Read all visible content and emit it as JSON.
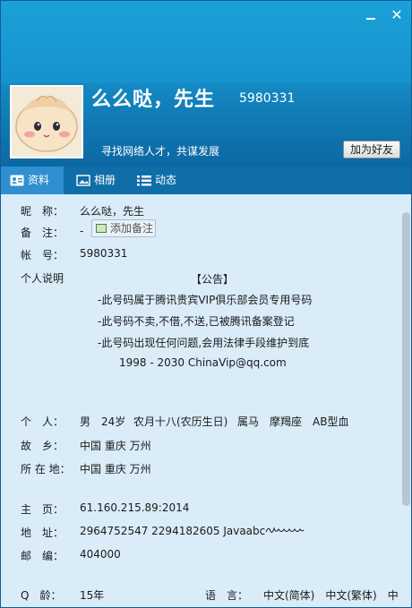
{
  "window": {
    "minimize_label": "—",
    "close_label": "✕"
  },
  "profile": {
    "nickname": "么么哒，先生",
    "qq_number": "5980331",
    "slogan": "寻找网络人才，共谋发展",
    "add_friend_label": "加为好友"
  },
  "tabs": [
    {
      "label": "资料",
      "icon": "profile-card-icon"
    },
    {
      "label": "相册",
      "icon": "photo-album-icon"
    },
    {
      "label": "动态",
      "icon": "list-feed-icon"
    }
  ],
  "info": {
    "nickname_label": "昵　称：",
    "nickname_value": "么么哒，先生",
    "remark_label": "备　注：",
    "remark_value": "-",
    "remark_button": "添加备注",
    "account_label": "帐　号：",
    "account_value": "5980331",
    "personal_desc_label": "个人说明",
    "notice_title": "【公告】",
    "notice_lines": [
      "-此号码属于腾讯贵宾VIP俱乐部会员专用号码",
      "-此号码不卖,不借,不送,已被腾讯备案登记",
      "-此号码出现任何问题,会用法律手段维护到底",
      "1998 - 2030 ChinaVip@qq.com"
    ],
    "person_label": "个　人：",
    "person_gender": "男",
    "person_age": "24岁",
    "person_birthday": "农月十八(农历生日)",
    "person_zodiac": "属马",
    "person_constellation": "摩羯座",
    "person_blood": "AB型血",
    "hometown_label": "故　乡：",
    "hometown_value": "中国 重庆 万州",
    "location_label": "所 在 地：",
    "location_value": "中国 重庆 万州",
    "homepage_label": "主　页：",
    "homepage_value": "61.160.215.89:2014",
    "address_label": "地　址：",
    "address_value": "2964752547 2294182605 Javaabc",
    "postcode_label": "邮　编：",
    "postcode_value": "404000",
    "qage_label": "Q　龄：",
    "qage_value": "15年",
    "language_label": "语　言：",
    "language_value": "中文(简体)　中文(繁体)　中"
  },
  "colors": {
    "header_blue": "#1794cf",
    "tab_bar": "#0f6da8",
    "tab_active": "#2f8fd0",
    "content_bg": "#d9ecf8"
  }
}
